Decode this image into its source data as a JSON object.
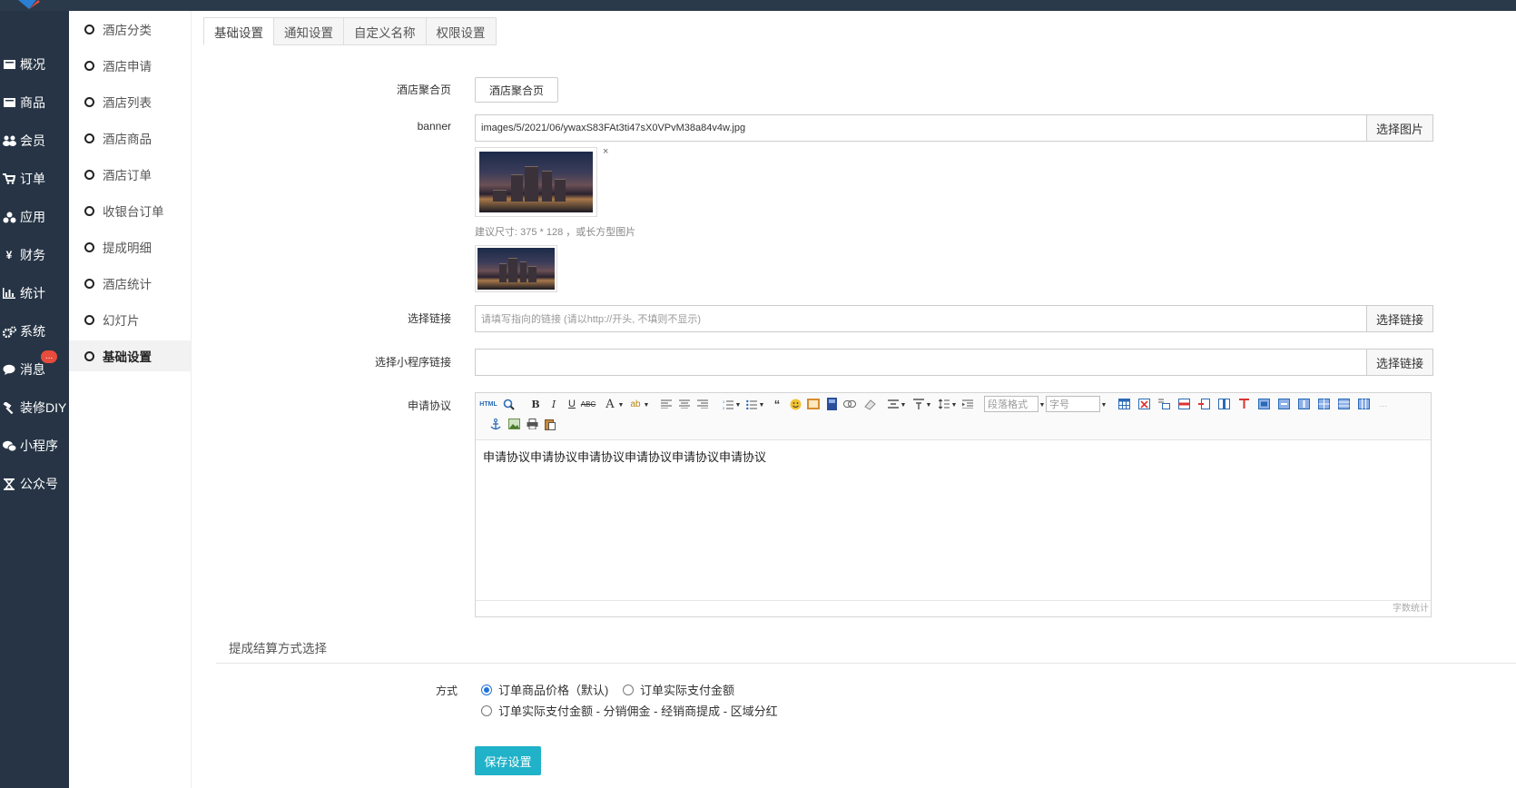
{
  "sidebar": {
    "items": [
      {
        "label": "概况",
        "icon": "dashboard-icon"
      },
      {
        "label": "商品",
        "icon": "box-icon"
      },
      {
        "label": "会员",
        "icon": "users-icon"
      },
      {
        "label": "订单",
        "icon": "cart-icon"
      },
      {
        "label": "应用",
        "icon": "apps-icon"
      },
      {
        "label": "财务",
        "icon": "yen-icon"
      },
      {
        "label": "统计",
        "icon": "bar-chart-icon"
      },
      {
        "label": "系统",
        "icon": "gears-icon"
      },
      {
        "label": "消息",
        "icon": "chat-icon",
        "badge": "..."
      },
      {
        "label": "装修DIY",
        "icon": "hammer-icon"
      },
      {
        "label": "小程序",
        "icon": "wechat-icon"
      },
      {
        "label": "公众号",
        "icon": "hourglass-icon"
      }
    ]
  },
  "subnav": {
    "items": [
      {
        "label": "酒店分类"
      },
      {
        "label": "酒店申请"
      },
      {
        "label": "酒店列表"
      },
      {
        "label": "酒店商品"
      },
      {
        "label": "酒店订单"
      },
      {
        "label": "收银台订单"
      },
      {
        "label": "提成明细"
      },
      {
        "label": "酒店统计"
      },
      {
        "label": "幻灯片"
      },
      {
        "label": "基础设置",
        "active": true
      }
    ]
  },
  "tabs": [
    {
      "label": "基础设置",
      "active": true
    },
    {
      "label": "通知设置"
    },
    {
      "label": "自定义名称"
    },
    {
      "label": "权限设置"
    }
  ],
  "form": {
    "aggregate_page": {
      "label": "酒店聚合页",
      "button": "酒店聚合页"
    },
    "banner": {
      "label": "banner",
      "value": "images/5/2021/06/ywaxS83FAt3ti47sX0VPvM38a84v4w.jpg",
      "button": "选择图片",
      "remove": "×",
      "hint": "建议尺寸: 375 * 128 ，或长方型图片"
    },
    "link": {
      "label": "选择链接",
      "placeholder": "请填写指向的链接 (请以http://开头, 不填则不显示)",
      "button": "选择链接"
    },
    "mini_link": {
      "label": "选择小程序链接",
      "value": "",
      "button": "选择链接"
    },
    "agreement": {
      "label": "申请协议",
      "content": "申请协议申请协议申请协议申请协议申请协议申请协议",
      "format_select": "段落格式",
      "size_select": "字号",
      "word_count": "字数统计"
    }
  },
  "settlement": {
    "title": "提成结算方式选择",
    "label": "方式",
    "options": [
      {
        "label": "订单商品价格（默认)",
        "checked": true
      },
      {
        "label": "订单实际支付金额",
        "checked": false
      },
      {
        "label": "订单实际支付金额 - 分销佣金 - 经销商提成 - 区域分红",
        "checked": false
      }
    ]
  },
  "save_button": "保存设置",
  "colors": {
    "sidebar": "#263445",
    "primary": "#1fb2c8",
    "badge": "#e74c3c"
  }
}
